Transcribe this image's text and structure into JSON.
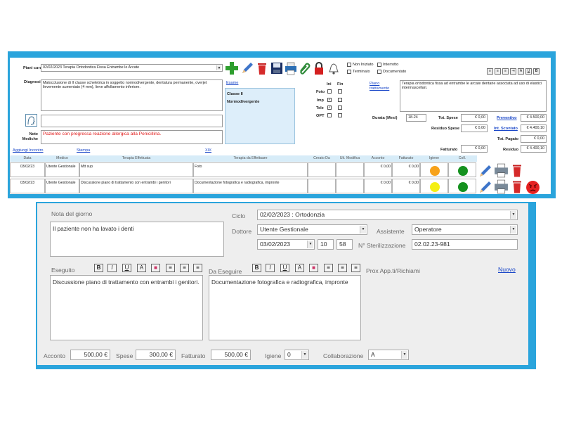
{
  "top": {
    "piano_cura_label": "Piani cura",
    "piano_cura_value": "02/02/2023 Terapia Ortodontica Fissa Entrambe le Arcate",
    "status_options": [
      {
        "label": "Non Iniziato",
        "checked": false
      },
      {
        "label": "Interrotto",
        "checked": false
      },
      {
        "label": "Terminato",
        "checked": false
      },
      {
        "label": "Documentato",
        "checked": false
      }
    ],
    "diagnosi_label": "Diagnosi",
    "diagnosi_text": "Malocclusione di II classe scheletrica in soggetto normodivergente, dentatura permanente, overjet lievemente aumentato (4 mm), lieve affollamento inferiore.",
    "esame_label": "Esame",
    "esame_lines": [
      "Classe II",
      "Normodivergente"
    ],
    "ini_label": "Ini",
    "fin_label": "Fin",
    "exam_rows": [
      {
        "label": "Foto",
        "ini": "",
        "fin": ""
      },
      {
        "label": "Imp",
        "ini": "✓",
        "fin": ""
      },
      {
        "label": "Tele",
        "ini": "✓",
        "fin": ""
      },
      {
        "label": "OPT",
        "ini": "",
        "fin": ""
      }
    ],
    "piano_trattamento_label": "Piano trattamento",
    "piano_trattamento_text": "Terapia ortodontica fissa ad entrambe le arcate dentarie associata ad uso di elastici intermascellari.",
    "note_mediche_label": "Note Mediche",
    "note_mediche_text": "Paziente con pregressa reazione allergica alla Penicillina.",
    "durata_label": "Durata (Mesi)",
    "durata_value": "18-24",
    "tot_spese_label": "Tot. Spese",
    "tot_spese_value": "€ 0,00",
    "preventivo_label": "Preventivo",
    "preventivo_value": "€ 4.500,00",
    "residuo_spese_label": "Residuo Spese",
    "residuo_spese_value": "€ 0,00",
    "int_scontato_label": "Int. Scontato",
    "int_scontato_value": "€ 4.400,10",
    "tot_pagato_label": "Tot. Pagato",
    "tot_pagato_value": "€ 0,00",
    "fatturato_label": "Fatturato",
    "fatturato_value": "€ 0,00",
    "residuo_label": "Residuo",
    "residuo_value": "€ 4.400,10",
    "links": [
      "Aggiungi Incontro",
      "Stampa",
      "XIX"
    ],
    "table_headers": [
      "Data",
      "Medico",
      "Terapia Effettuata",
      "Terapia da Effettuare",
      "Creato Da",
      "Ult. Modifica",
      "Acconto",
      "Fatturato",
      "Igiene",
      "Coll."
    ],
    "table_rows": [
      {
        "data": "03/02/23",
        "medico": "Utente Gestionale",
        "effettuata": "Mtt sup",
        "da_effettuare": "Foto",
        "creato": "",
        "modifica": "",
        "acconto": "€ 0,00",
        "fatturato": "€ 0,00",
        "igiene_color": "#f7a21b",
        "coll_color": "#14911e"
      },
      {
        "data": "03/02/23",
        "medico": "Utente Gestionale",
        "effettuata": "Discussione piano di trattamento con entrambi i genitori",
        "da_effettuare": "Documentazione fotografica e radiografica, impronte",
        "creato": "",
        "modifica": "",
        "acconto": "€ 0,00",
        "fatturato": "€ 0,00",
        "igiene_color": "#f5ef12",
        "coll_color": "#14911e"
      }
    ],
    "format_buttons": [
      "≡",
      "≡",
      "≡",
      "⇥",
      "A",
      "U",
      "B"
    ]
  },
  "bottom": {
    "nota_label": "Nota del giorno",
    "nota_text": "Il paziente non ha lavato i denti",
    "ciclo_label": "Ciclo",
    "ciclo_value": "02/02/2023 : Ortodonzia",
    "dottore_label": "Dottore",
    "dottore_value": "Utente Gestionale",
    "assistente_label": "Assistente",
    "assistente_value": "Operatore",
    "data_value": "03/02/2023",
    "ora_value": "10",
    "minuti_value": "58",
    "sterilizzazione_label": "N° Sterilizzazione",
    "sterilizzazione_value": "02.02.23-981",
    "eseguito_label": "Eseguito",
    "eseguito_text": "Discussione piano di trattamento con entrambi i genitori.",
    "da_eseguire_label": "Da Eseguire",
    "da_eseguire_text": "Documentazione fotografica e radiografica, impronte",
    "prox_label": "Prox App.ti/Richiami",
    "nuovo_label": "Nuovo",
    "format_buttons": [
      "B",
      "I",
      "U",
      "A",
      "■",
      "≡",
      "≡",
      "≡"
    ],
    "acconto_label": "Acconto",
    "acconto_value": "500,00 €",
    "spese_label": "Spese",
    "spese_value": "300,00 €",
    "fatturato_label": "Fatturato",
    "fatturato_value": "500,00 €",
    "igiene_label": "Igiene",
    "igiene_value": "0",
    "collaborazione_label": "Collaborazione",
    "collaborazione_value": "A"
  },
  "colors": {
    "frame_blue": "#2aa4dc",
    "note_red": "#e01919",
    "link_blue": "#1a47c8"
  }
}
